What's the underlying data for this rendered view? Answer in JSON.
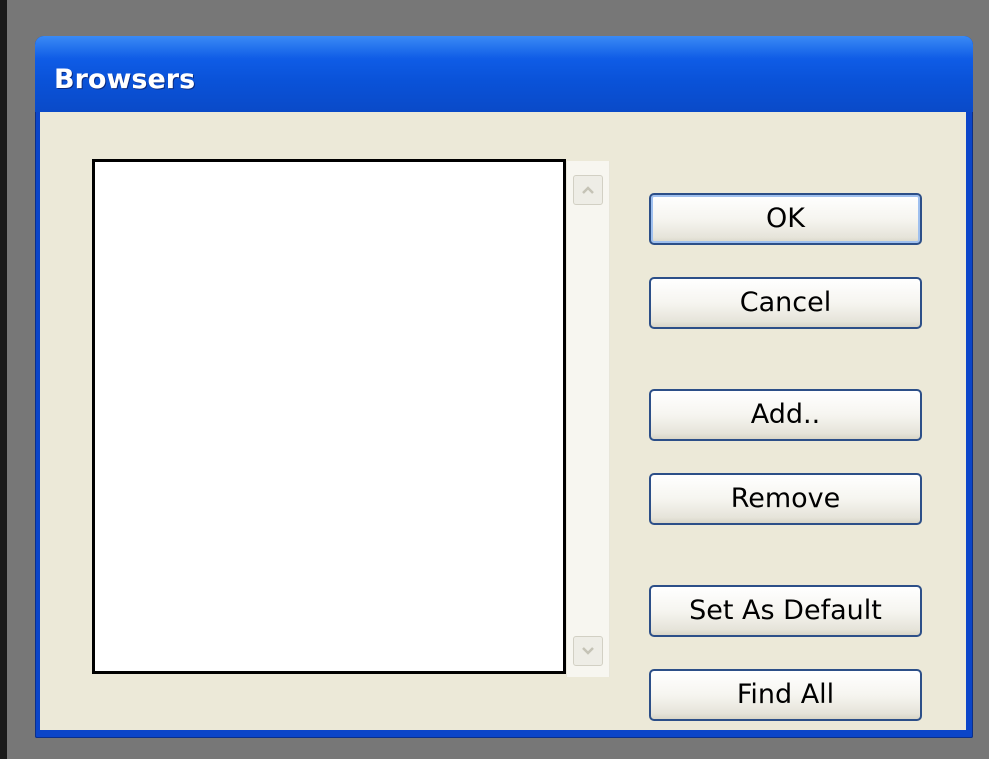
{
  "window": {
    "title": "Browsers"
  },
  "browser_list": {
    "items": []
  },
  "scrollbar": {
    "up_icon": "chevron-up-icon",
    "down_icon": "chevron-down-icon"
  },
  "buttons": {
    "ok_label": "OK",
    "cancel_label": "Cancel",
    "add_label": "Add..",
    "remove_label": "Remove",
    "set_default_label": "Set As Default",
    "find_all_label": "Find All"
  },
  "colors": {
    "titlebar": "#0a52d8",
    "client_bg": "#ece9d8",
    "button_border": "#2c4f88"
  }
}
